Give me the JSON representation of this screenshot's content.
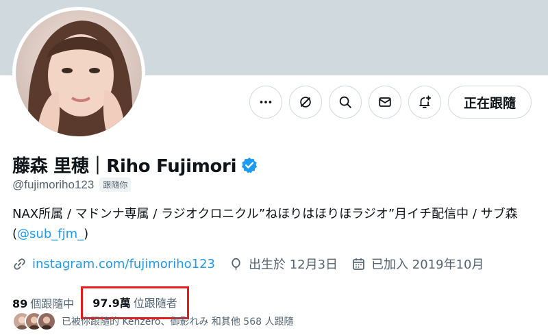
{
  "profile": {
    "display_name": "藤森 里穂｜Riho Fujimori",
    "handle": "@fujimoriho123",
    "follows_you": "跟隨你",
    "bio_text": "NAX所属 / マドンナ専属 / ラジオクロニクル”ねほりはほりほラジオ”月イチ配信中 / サブ森(",
    "bio_mention": "@sub_fjm_",
    "bio_suffix": ")"
  },
  "actions": {
    "more_icon": "more-horizontal-icon",
    "grok_icon": "grok-icon",
    "search_icon": "search-icon",
    "message_icon": "envelope-icon",
    "notify_icon": "bell-plus-icon",
    "follow_label": "正在跟隨"
  },
  "meta": {
    "website": "instagram.com/fujimoriho123",
    "birthday": "出生於 12月3日",
    "joined": "已加入 2019年10月"
  },
  "stats": {
    "following_count": "89",
    "following_label": "個跟隨中",
    "followers_count": "97.9萬",
    "followers_label": "位跟隨者"
  },
  "known_followers": {
    "text": "已被你跟隨的 Kenzero、御影れみ 和其他 568 人跟隨"
  },
  "colors": {
    "banner": "#cfd9de",
    "link": "#1d9bf0",
    "verified": "#1d9bf0",
    "highlight_box": "#e81c1c"
  }
}
